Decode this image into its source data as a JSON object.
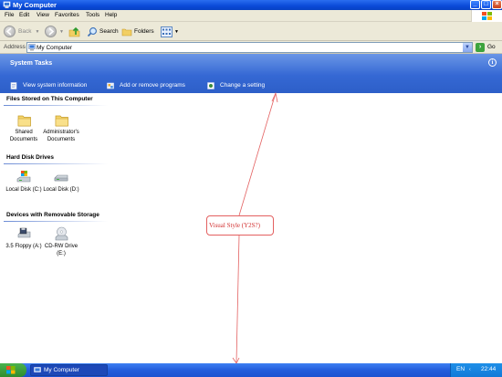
{
  "window": {
    "title": "My Computer"
  },
  "menu": [
    "File",
    "Edit",
    "View",
    "Favorites",
    "Tools",
    "Help"
  ],
  "toolbar": {
    "back": "Back",
    "search": "Search",
    "folders": "Folders"
  },
  "address": {
    "label": "Address",
    "value": "My Computer",
    "go": "Go"
  },
  "system_tasks": {
    "header": "System Tasks",
    "items": [
      "View system information",
      "Add or remove programs",
      "Change a setting"
    ]
  },
  "sections": [
    {
      "title": "Files Stored on This Computer",
      "items": [
        {
          "label": "Shared Documents",
          "icon": "folder-icon"
        },
        {
          "label": "Administrator's Documents",
          "icon": "folder-icon"
        }
      ]
    },
    {
      "title": "Hard Disk Drives",
      "items": [
        {
          "label": "Local Disk (C:)",
          "icon": "system-drive-icon"
        },
        {
          "label": "Local Disk (D:)",
          "icon": "hard-drive-icon"
        }
      ]
    },
    {
      "title": "Devices with Removable Storage",
      "items": [
        {
          "label": "3.5 Floppy (A:)",
          "icon": "floppy-drive-icon"
        },
        {
          "label": "CD-RW Drive (E:)",
          "icon": "cd-drive-icon"
        }
      ]
    }
  ],
  "annotation": {
    "text": "Visual Style (Y2S?)"
  },
  "taskbar": {
    "window_button": "My Computer",
    "language": "EN",
    "clock": "22:44"
  },
  "colors": {
    "titlebar": "#0a4ad8",
    "task_pane": "#3568d4",
    "annotation": "#e36060"
  }
}
